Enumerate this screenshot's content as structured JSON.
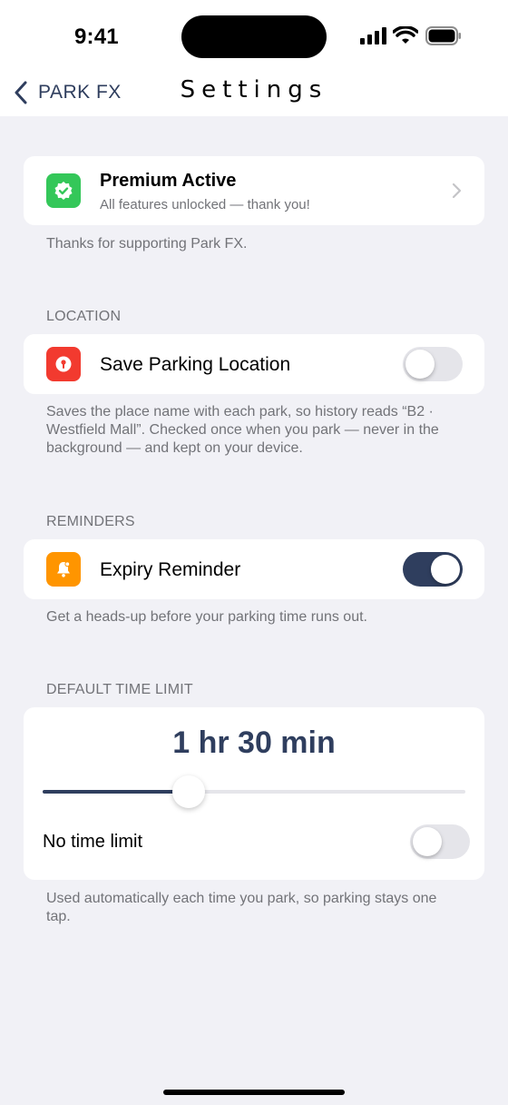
{
  "status_bar": {
    "time": "9:41"
  },
  "nav": {
    "back_label": "PARK FX",
    "title": "Settings"
  },
  "premium": {
    "title": "Premium Active",
    "subtitle": "All features unlocked — thank you!",
    "footer": "Thanks for supporting Park FX.",
    "icon": "verified-check-icon",
    "icon_color": "#34c759"
  },
  "location": {
    "header": "LOCATION",
    "label": "Save Parking Location",
    "enabled": false,
    "icon": "location-pin-icon",
    "icon_color": "#f23a2f",
    "footer": "Saves the place name with each park, so history reads “B2 · Westfield Mall”. Checked once when you park — never in the background — and kept on your device."
  },
  "reminders": {
    "header": "REMINDERS",
    "label": "Expiry Reminder",
    "enabled": true,
    "icon": "bell-icon",
    "icon_color": "#ff9500",
    "footer": "Get a heads-up before your parking time runs out."
  },
  "time_limit": {
    "header": "DEFAULT TIME LIMIT",
    "value_label": "1 hr 30 min",
    "slider_fraction": 0.345,
    "no_limit_label": "No time limit",
    "no_limit_enabled": false,
    "footer": "Used automatically each time you park, so parking stays one tap."
  },
  "colors": {
    "accent": "#2f3e5e",
    "background": "#f1f1f6",
    "secondary_text": "#727378"
  }
}
